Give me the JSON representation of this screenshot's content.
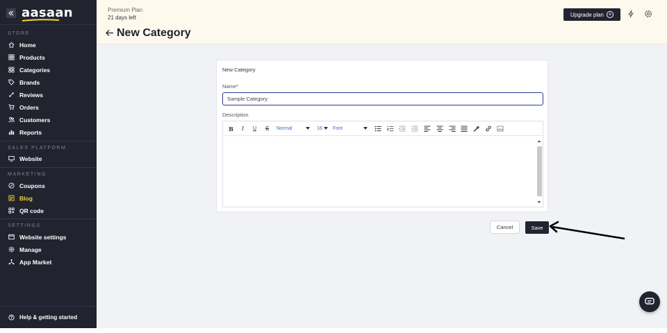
{
  "brand": {
    "logo_text": "aasaan",
    "accent": "#f5d535",
    "dark": "#21232f"
  },
  "sidebar": {
    "sections": [
      {
        "title": "STORE",
        "items": [
          {
            "label": "Home",
            "icon": "home-icon"
          },
          {
            "label": "Products",
            "icon": "products-icon"
          },
          {
            "label": "Categories",
            "icon": "categories-icon"
          },
          {
            "label": "Brands",
            "icon": "tag-icon"
          },
          {
            "label": "Reviews",
            "icon": "reviews-icon"
          },
          {
            "label": "Orders",
            "icon": "cart-icon"
          },
          {
            "label": "Customers",
            "icon": "users-icon"
          },
          {
            "label": "Reports",
            "icon": "chart-icon"
          }
        ]
      },
      {
        "title": "SALES PLATFORM",
        "items": [
          {
            "label": "Website",
            "icon": "monitor-icon"
          }
        ]
      },
      {
        "title": "MARKETING",
        "items": [
          {
            "label": "Coupons",
            "icon": "coupon-icon"
          },
          {
            "label": "Blog",
            "icon": "blog-icon",
            "active": true
          },
          {
            "label": "QR code",
            "icon": "qr-icon"
          }
        ]
      },
      {
        "title": "SETTINGS",
        "items": [
          {
            "label": "Website settings",
            "icon": "website-settings-icon"
          },
          {
            "label": "Manage",
            "icon": "gear-icon"
          },
          {
            "label": "App Market",
            "icon": "app-market-icon"
          }
        ]
      }
    ],
    "help_label": "Help & getting started"
  },
  "header": {
    "plan_name": "Premium Plan",
    "plan_days": "21 days left",
    "title": "New Category",
    "upgrade_label": "Upgrade plan"
  },
  "form": {
    "card_title": "New Category",
    "name_label": "Name*",
    "name_value": "Sample Category",
    "description_label": "Description",
    "toolbar": {
      "format": "Normal",
      "size": "16",
      "font": "Font"
    },
    "cancel_label": "Cancel",
    "save_label": "Save"
  }
}
